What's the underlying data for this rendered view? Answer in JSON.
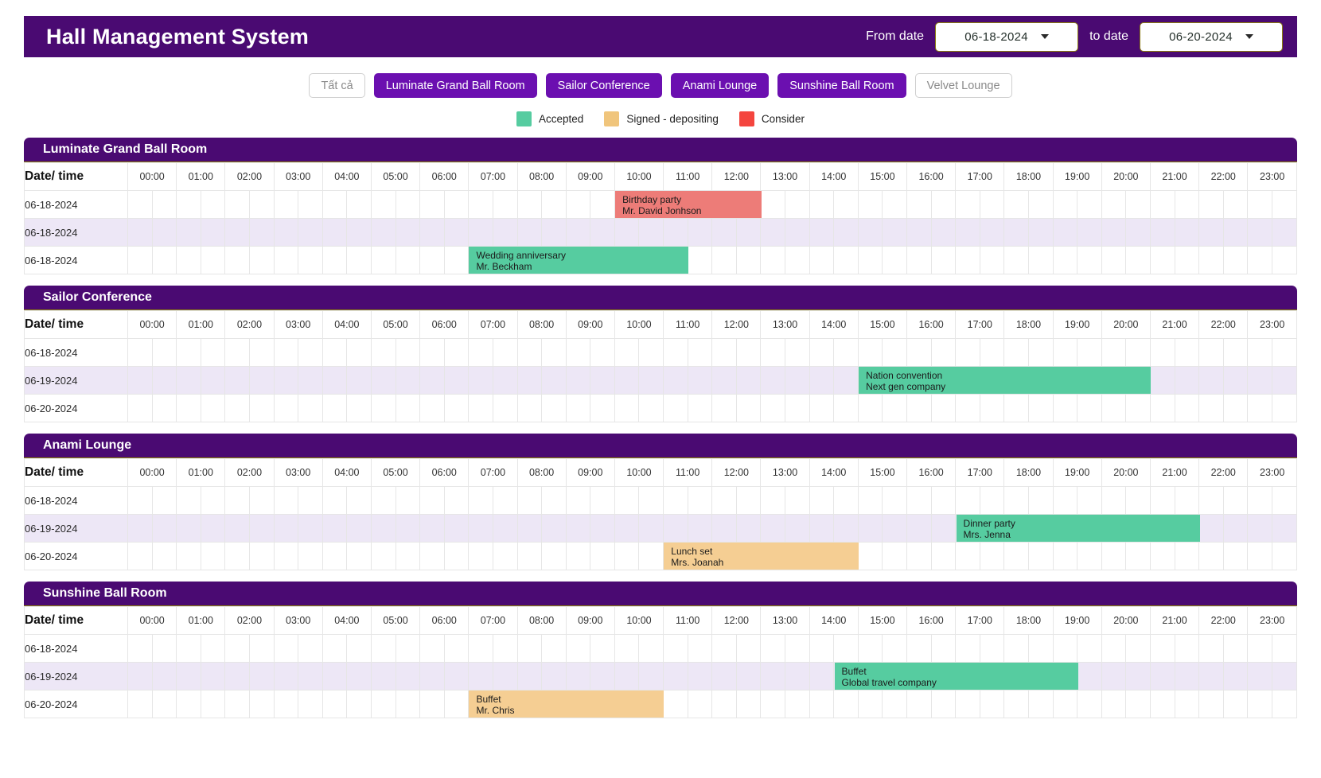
{
  "header": {
    "title": "Hall Management System",
    "from_label": "From date",
    "from_value": "06-18-2024",
    "to_label": "to date",
    "to_value": "06-20-2024"
  },
  "filters": [
    {
      "label": "Tất cả",
      "active": false
    },
    {
      "label": "Luminate Grand Ball Room",
      "active": true
    },
    {
      "label": "Sailor Conference",
      "active": true
    },
    {
      "label": "Anami Lounge",
      "active": true
    },
    {
      "label": "Sunshine Ball Room",
      "active": true
    },
    {
      "label": "Velvet Lounge",
      "active": false
    }
  ],
  "legend": [
    {
      "label": "Accepted",
      "color": "#56CCA0"
    },
    {
      "label": "Signed - depositing",
      "color": "#F0C57C"
    },
    {
      "label": "Consider",
      "color": "#F4453E"
    }
  ],
  "colors": {
    "brand_purple": "#4A0A72",
    "chip_purple": "#6B0FB0",
    "alt_row": "#EDE7F6",
    "accepted": "#56CCA0",
    "signed": "#F5CE93",
    "consider": "#ED7C78"
  },
  "date_time_header": "Date/ time",
  "hours": [
    "00:00",
    "01:00",
    "02:00",
    "03:00",
    "04:00",
    "05:00",
    "06:00",
    "07:00",
    "08:00",
    "09:00",
    "10:00",
    "11:00",
    "12:00",
    "13:00",
    "14:00",
    "15:00",
    "16:00",
    "17:00",
    "18:00",
    "19:00",
    "20:00",
    "21:00",
    "22:00",
    "23:00"
  ],
  "tables": [
    {
      "room": "Luminate Grand Ball Room",
      "rows": [
        {
          "date": "06-18-2024",
          "events": [
            {
              "title": "Birthday party",
              "sub": "Mr. David Jonhson",
              "start": 10.0,
              "end": 13.0,
              "status": "consider"
            }
          ]
        },
        {
          "date": "06-18-2024",
          "events": []
        },
        {
          "date": "06-18-2024",
          "events": [
            {
              "title": "Wedding anniversary",
              "sub": "Mr. Beckham",
              "start": 7.0,
              "end": 11.5,
              "status": "accepted"
            }
          ]
        }
      ]
    },
    {
      "room": "Sailor Conference",
      "rows": [
        {
          "date": "06-18-2024",
          "events": []
        },
        {
          "date": "06-19-2024",
          "events": [
            {
              "title": "Nation convention",
              "sub": "Next gen company",
              "start": 15.0,
              "end": 21.0,
              "status": "accepted"
            }
          ]
        },
        {
          "date": "06-20-2024",
          "events": []
        }
      ]
    },
    {
      "room": "Anami Lounge",
      "rows": [
        {
          "date": "06-18-2024",
          "events": []
        },
        {
          "date": "06-19-2024",
          "events": [
            {
              "title": "Dinner party",
              "sub": "Mrs. Jenna",
              "start": 17.0,
              "end": 22.0,
              "status": "accepted"
            }
          ]
        },
        {
          "date": "06-20-2024",
          "events": [
            {
              "title": "Lunch set",
              "sub": "Mrs. Joanah",
              "start": 11.0,
              "end": 15.0,
              "status": "signed"
            }
          ]
        }
      ]
    },
    {
      "room": "Sunshine Ball Room",
      "rows": [
        {
          "date": "06-18-2024",
          "events": []
        },
        {
          "date": "06-19-2024",
          "events": [
            {
              "title": "Buffet",
              "sub": "Global travel company",
              "start": 14.5,
              "end": 19.5,
              "status": "accepted"
            }
          ]
        },
        {
          "date": "06-20-2024",
          "events": [
            {
              "title": "Buffet",
              "sub": "Mr. Chris",
              "start": 7.0,
              "end": 11.0,
              "status": "signed"
            }
          ]
        }
      ]
    }
  ]
}
